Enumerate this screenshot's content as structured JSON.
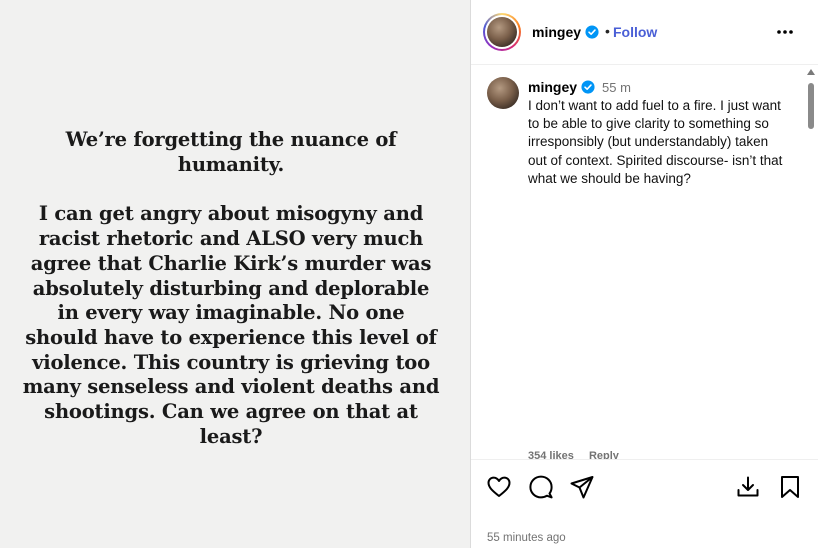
{
  "post": {
    "headline": "We’re forgetting the nuance of humanity.",
    "body": "I can get angry about misogyny and racist rhetoric and ALSO very much agree that Charlie Kirk’s murder was absolutely disturbing and deplorable in every way imaginable. No one should have to experience this level of violence. This country is grieving too many senseless and violent deaths and shootings. Can we agree on that at least?"
  },
  "header": {
    "username": "mingey",
    "separator": "•",
    "follow_label": "Follow"
  },
  "caption": {
    "username": "mingey",
    "time": "55 m",
    "text": "I don’t want to add fuel to a fire. I just want to be able to give clarity to something so irresponsibly (but understandably) taken out of context. Spirited discourse- isn’t that what we should be having?",
    "likes": "354 likes",
    "reply": "Reply"
  },
  "footer": {
    "timestamp": "55 minutes ago"
  },
  "icons": {
    "verified": "verified-badge-icon",
    "more": "more-options-icon",
    "like": "heart-icon",
    "comment": "comment-icon",
    "share": "share-icon",
    "download": "download-icon",
    "save": "bookmark-icon"
  },
  "colors": {
    "follow": "#4a5fd6",
    "verified": "#0095f6",
    "image_background": "#f1f1f0"
  }
}
